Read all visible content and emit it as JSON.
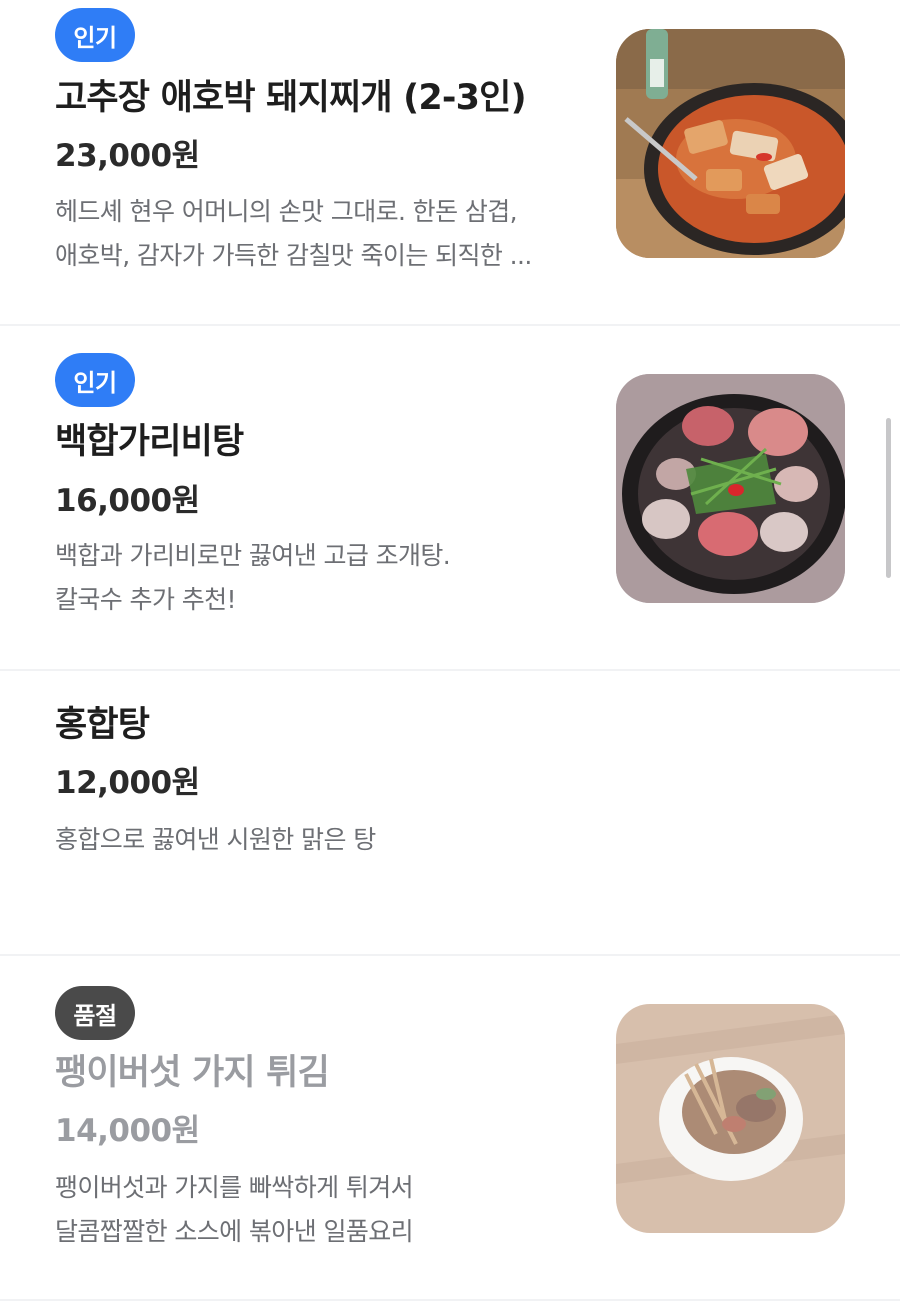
{
  "menu": {
    "items": [
      {
        "badge": "인기",
        "name": "고추장 애호박 돼지찌개 (2-3인)",
        "price": "23,000원",
        "desc_lines": [
          "헤드셰 현우 어머니의 손맛 그대로. 한돈 삼겹,",
          "애호박, 감자가 가득한 감칠맛 죽이는 되직한 ..."
        ],
        "image": "pork-zucchini-stew-photo"
      },
      {
        "badge": "인기",
        "name": "백합가리비탕",
        "price": "16,000원",
        "desc_lines": [
          "백합과 가리비로만 끓여낸 고급 조개탕.",
          "칼국수 추가 추천!"
        ],
        "image": "clam-scallop-soup-photo"
      },
      {
        "badge": "",
        "name": "홍합탕",
        "price": "12,000원",
        "desc_lines": [
          "홍합으로 끓여낸 시원한 맑은 탕"
        ],
        "image": ""
      },
      {
        "badge": "품절",
        "name": "팽이버섯 가지 튀김",
        "price": "14,000원",
        "desc_lines": [
          "팽이버섯과 가지를 빠싹하게 튀겨서",
          "달콤짭짤한 소스에 볶아낸 일품요리"
        ],
        "image": "enoki-eggplant-fry-photo"
      }
    ]
  },
  "colors": {
    "popular_badge": "#2f7df6",
    "soldout_badge": "#4a4a4a",
    "title_text": "#1e1e1e",
    "desc_text": "#6d6f74",
    "soldout_text": "#9a9ca1",
    "divider": "#f1f2f4"
  }
}
